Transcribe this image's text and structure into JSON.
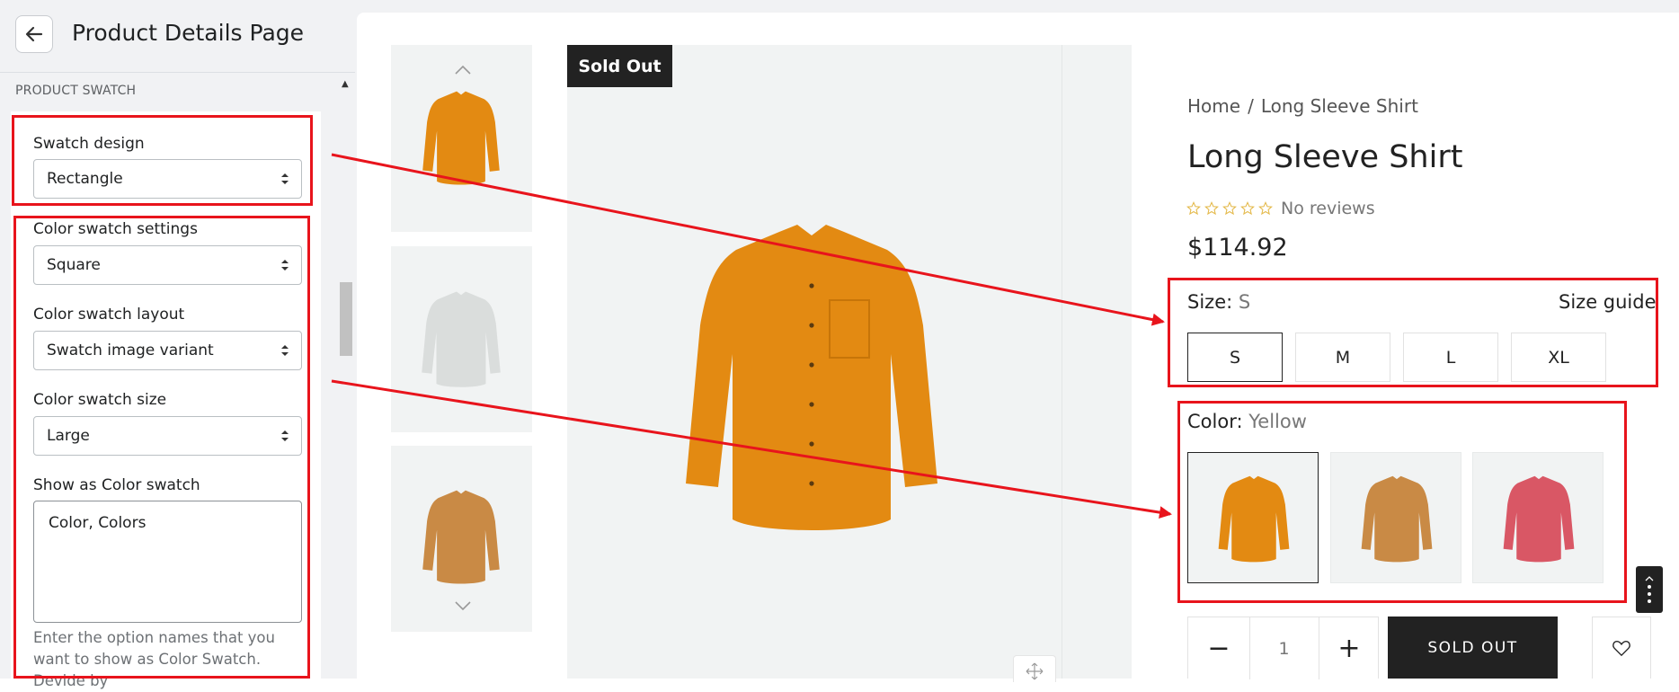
{
  "editor": {
    "header": {
      "title": "Product Details Page"
    },
    "section_label": "PRODUCT SWATCH",
    "fields": {
      "swatch_design": {
        "label": "Swatch design",
        "value": "Rectangle"
      },
      "color_swatch_settings": {
        "label": "Color swatch settings",
        "value": "Square"
      },
      "color_swatch_layout": {
        "label": "Color swatch layout",
        "value": "Swatch image variant"
      },
      "color_swatch_size": {
        "label": "Color swatch size",
        "value": "Large"
      },
      "show_as_color_swatch": {
        "label": "Show as Color swatch",
        "value": "Color, Colors"
      }
    },
    "help_text": "Enter the option names that you want to show as Color Swatch. Devide by"
  },
  "product": {
    "badge": "Sold Out",
    "breadcrumb": {
      "home": "Home",
      "separator": "/",
      "current": "Long Sleeve Shirt"
    },
    "title": "Long Sleeve Shirt",
    "rating_stars": 5,
    "rating_filled": 0,
    "reviews_text": "No reviews",
    "price": "$114.92",
    "size": {
      "label": "Size:",
      "selected": "S",
      "guide": "Size guide",
      "options": [
        "S",
        "M",
        "L",
        "XL"
      ]
    },
    "color": {
      "label": "Color:",
      "selected": "Yellow"
    },
    "quantity": "1",
    "sold_out_button": "SOLD OUT",
    "colors": {
      "orange": "#E38A12",
      "tan": "#C98A45",
      "red": "#D95765",
      "white": "#DADDDC",
      "annotation": "#E8141C",
      "dark": "#222222"
    }
  }
}
